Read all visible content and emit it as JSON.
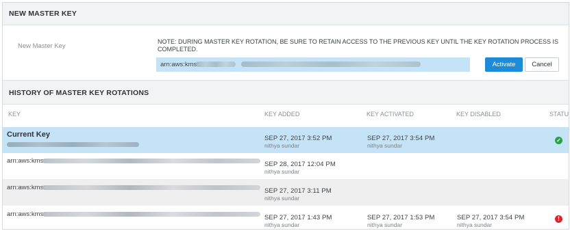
{
  "new_master_key": {
    "section_title": "NEW MASTER KEY",
    "field_label": "New Master Key",
    "note": "NOTE: DURING MASTER KEY ROTATION, BE SURE TO RETAIN ACCESS TO THE PREVIOUS KEY UNTIL THE KEY ROTATION PROCESS IS COMPLETED.",
    "arn_prefix": "arn:aws:kms:",
    "activate_label": "Activate",
    "cancel_label": "Cancel"
  },
  "history": {
    "section_title": "HISTORY OF MASTER KEY ROTATIONS",
    "columns": {
      "key": "KEY",
      "key_added": "KEY ADDED",
      "key_activated": "KEY ACTIVATED",
      "key_disabled": "KEY DISABLED",
      "status": "STATUS"
    },
    "rows": [
      {
        "key_label": "Current Key",
        "added_date": "SEP 27, 2017 3:52 PM",
        "added_user": "nithya sundar",
        "activated_date": "SEP 27, 2017 3:54 PM",
        "activated_user": "nithya sundar",
        "status": "ok"
      },
      {
        "key_label": "arn:aws:kms:",
        "added_date": "SEP 28, 2017 12:04 PM",
        "added_user": "nithya sundar"
      },
      {
        "key_label": "arn:aws:kms:",
        "added_date": "SEP 27, 2017 3:11 PM",
        "added_user": "nithya sundar"
      },
      {
        "key_label": "arn:aws:kms:",
        "added_date": "SEP 27, 2017 1:43 PM",
        "added_user": "nithya sundar",
        "activated_date": "SEP 27, 2017 1:53 PM",
        "activated_user": "nithya sundar",
        "disabled_date": "SEP 27, 2017 3:54 PM",
        "disabled_user": "nithya sundar",
        "status": "error"
      }
    ]
  },
  "icons": {
    "status_ok": "check-circle-icon",
    "status_error": "exclamation-circle-icon"
  },
  "colors": {
    "accent": "#1e8bd8",
    "selected_row": "#c5e3f6",
    "alt_row": "#efefef",
    "ok": "#2aa24a",
    "error": "#d9252a"
  }
}
